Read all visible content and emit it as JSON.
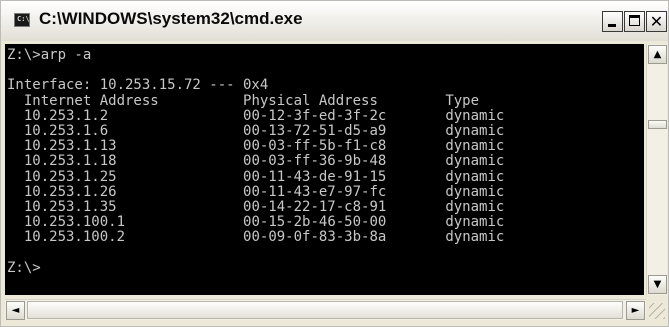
{
  "window": {
    "title": "C:\\WINDOWS\\system32\\cmd.exe",
    "icon": "cmd-icon",
    "icon_text": "C:\\"
  },
  "caption_buttons": {
    "minimize": "minimize-icon",
    "maximize": "maximize-icon",
    "close": "close-icon",
    "close_glyph": "✕"
  },
  "console": {
    "foreground": "#c7c7c7",
    "background": "#000000",
    "command_line": "Z:\\>arp -a",
    "interface_line": "Interface: 10.253.15.72 --- 0x4",
    "columns": [
      "Internet Address",
      "Physical Address",
      "Type"
    ],
    "entries": [
      {
        "ip": "10.253.1.2",
        "mac": "00-12-3f-ed-3f-2c",
        "type": "dynamic"
      },
      {
        "ip": "10.253.1.6",
        "mac": "00-13-72-51-d5-a9",
        "type": "dynamic"
      },
      {
        "ip": "10.253.1.13",
        "mac": "00-03-ff-5b-f1-c8",
        "type": "dynamic"
      },
      {
        "ip": "10.253.1.18",
        "mac": "00-03-ff-36-9b-48",
        "type": "dynamic"
      },
      {
        "ip": "10.253.1.25",
        "mac": "00-11-43-de-91-15",
        "type": "dynamic"
      },
      {
        "ip": "10.253.1.26",
        "mac": "00-11-43-e7-97-fc",
        "type": "dynamic"
      },
      {
        "ip": "10.253.1.35",
        "mac": "00-14-22-17-c8-91",
        "type": "dynamic"
      },
      {
        "ip": "10.253.100.1",
        "mac": "00-15-2b-46-50-00",
        "type": "dynamic"
      },
      {
        "ip": "10.253.100.2",
        "mac": "00-09-0f-83-3b-8a",
        "type": "dynamic"
      }
    ],
    "prompt": "Z:\\>"
  },
  "scrollbars": {
    "up_arrow": "▲",
    "down_arrow": "▼",
    "left_arrow": "◄",
    "right_arrow": "►"
  }
}
